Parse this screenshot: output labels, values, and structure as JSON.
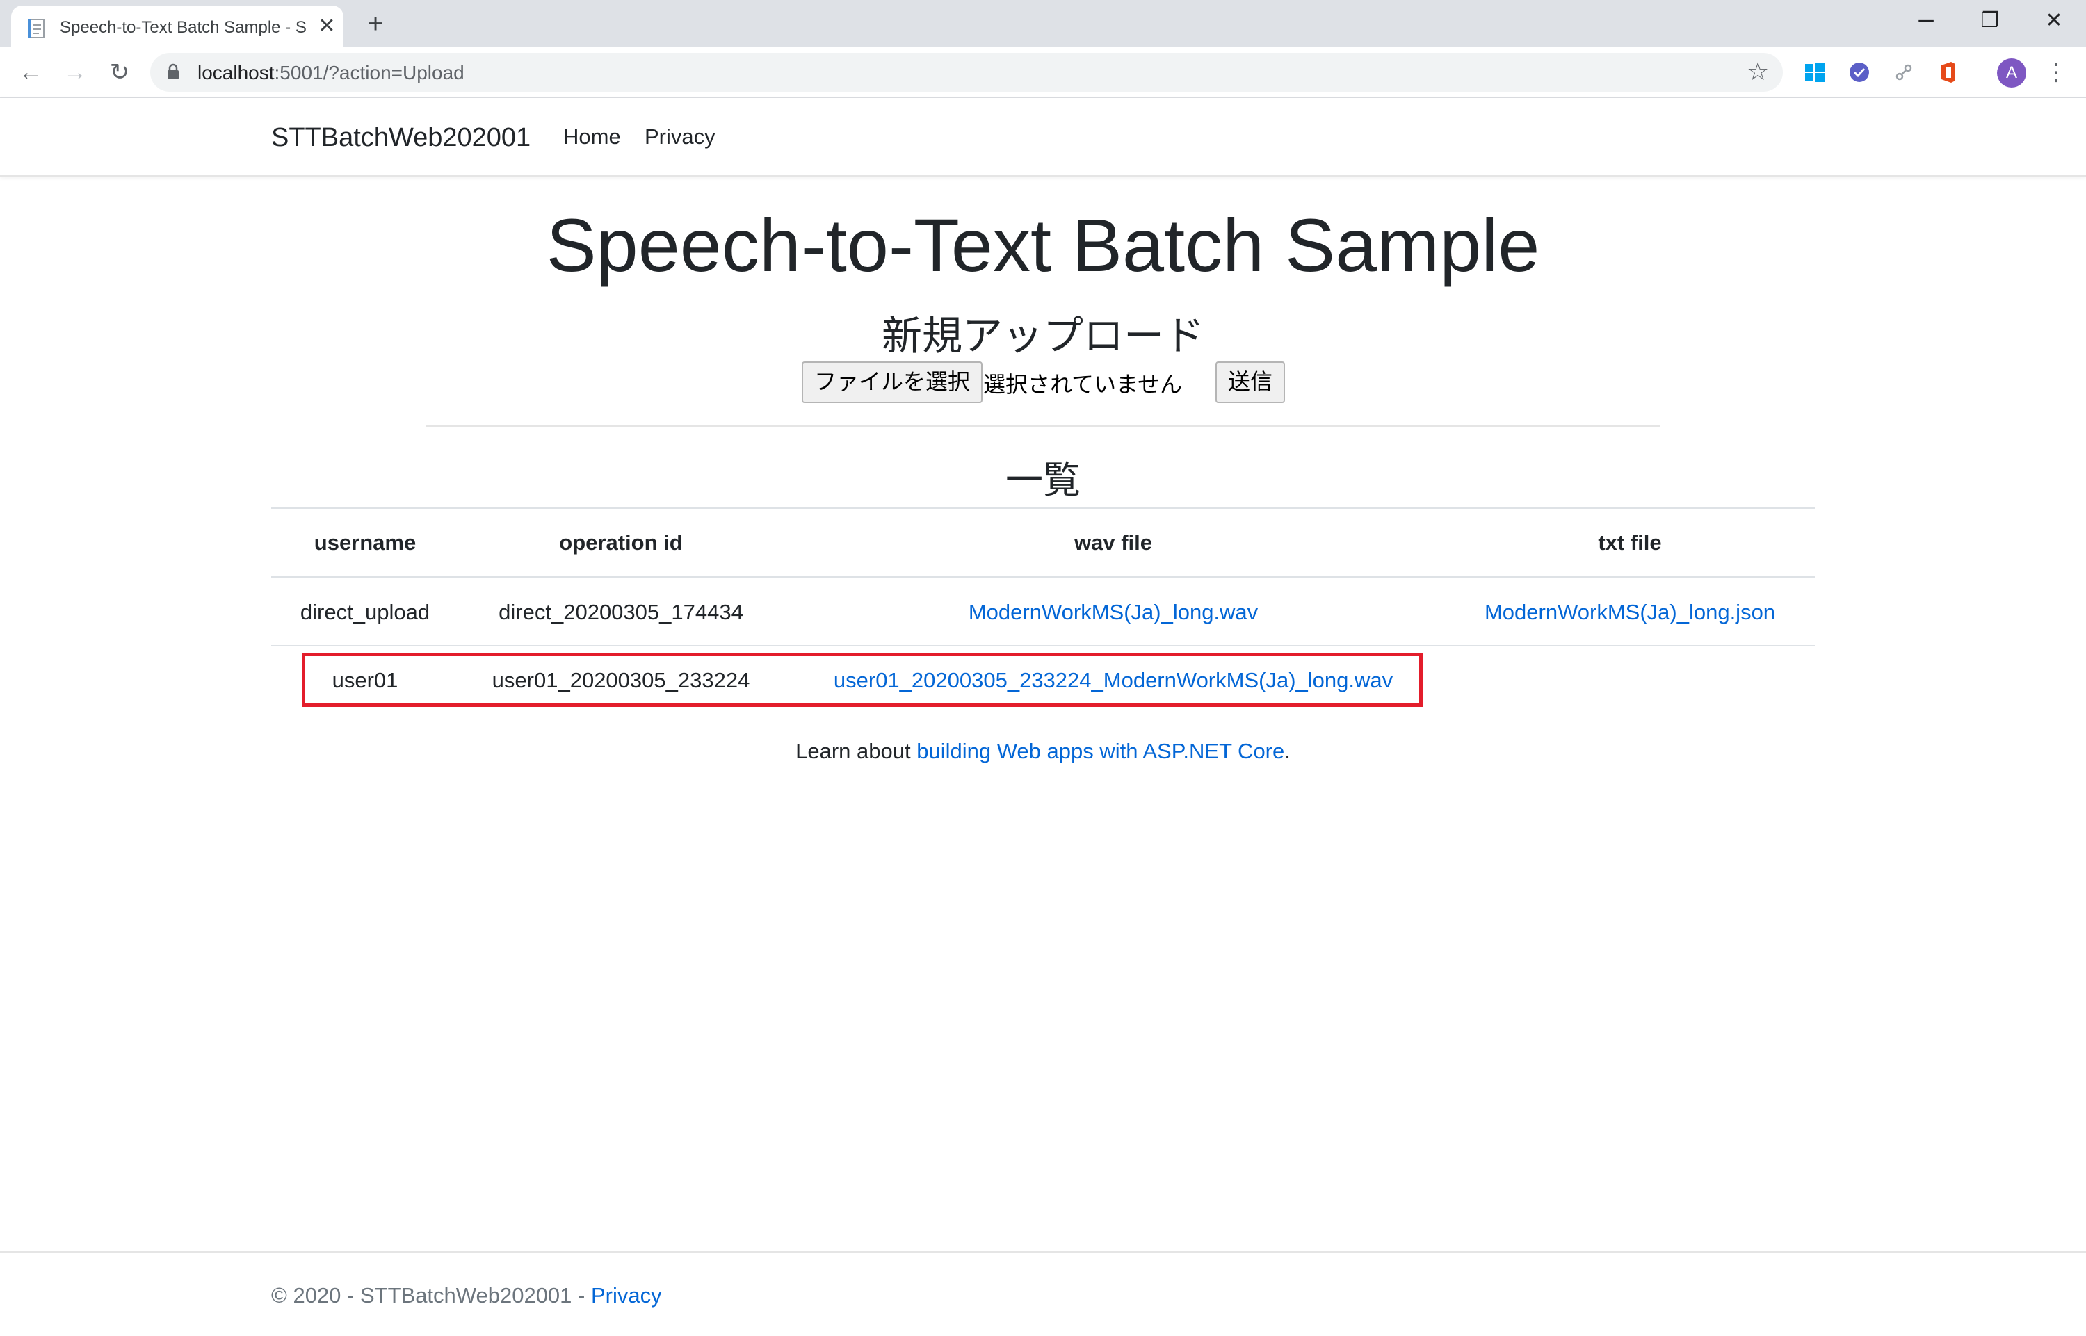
{
  "browser": {
    "tab_title": "Speech-to-Text Batch Sample - S",
    "new_tab": "+",
    "close_tab": "✕",
    "window_controls": {
      "minimize": "─",
      "maximize": "❐",
      "close": "✕"
    },
    "nav": {
      "back": "←",
      "forward": "→",
      "reload": "↻"
    },
    "url_host": "localhost",
    "url_rest": ":5001/?action=Upload",
    "bookmark": "☆",
    "avatar_letter": "A",
    "menu": "⋮"
  },
  "site": {
    "brand": "STTBatchWeb202001",
    "nav_items": [
      "Home",
      "Privacy"
    ]
  },
  "main": {
    "title": "Speech-to-Text Batch Sample",
    "upload_heading": "新規アップロード",
    "file_button": "ファイルを選択",
    "file_status": "選択されていません",
    "submit_button": "送信",
    "list_heading": "一覧",
    "table": {
      "headers": [
        "username",
        "operation id",
        "wav file",
        "txt file"
      ],
      "rows": [
        [
          "direct_upload",
          "direct_20200305_174434",
          "ModernWorkMS(Ja)_long.wav",
          "ModernWorkMS(Ja)_long.json"
        ],
        [
          "user01",
          "user01_20200305_233224",
          "user01_20200305_233224_ModernWorkMS(Ja)_long.wav",
          ""
        ]
      ]
    },
    "learn_prefix": "Learn about ",
    "learn_link": "building Web apps with ASP.NET Core",
    "learn_suffix": "."
  },
  "footer": {
    "text": "© 2020 - STTBatchWeb202001 - ",
    "privacy": "Privacy"
  },
  "colors": {
    "link": "#0366d6",
    "highlight": "#e31d2b"
  }
}
